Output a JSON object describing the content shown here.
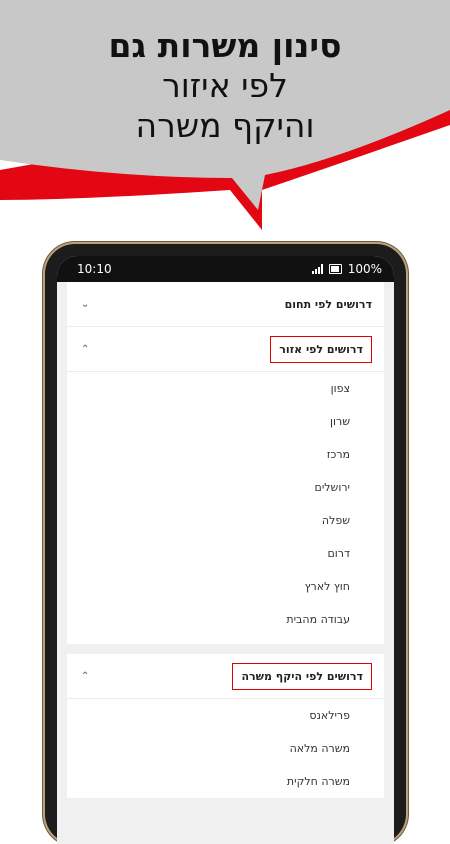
{
  "headline": {
    "line1": "סינון משרות גם",
    "line2": "לפי איזור",
    "line3": "והיקף משרה"
  },
  "status_bar": {
    "time": "10:10",
    "battery": "100%"
  },
  "sections": {
    "by_field": {
      "label": "דרושים לפי תחום"
    },
    "by_area": {
      "label": "דרושים לפי אזור",
      "items": [
        "צפון",
        "שרון",
        "מרכז",
        "ירושלים",
        "שפלה",
        "דרום",
        "חוץ לארץ",
        "עבודה מהבית"
      ]
    },
    "by_scope": {
      "label": "דרושים לפי היקף משרה",
      "items": [
        "פרילאנס",
        "משרה מלאה",
        "משרה חלקית"
      ]
    }
  },
  "colors": {
    "accent_red": "#e30613",
    "banner_gray": "#c8c8c8"
  }
}
